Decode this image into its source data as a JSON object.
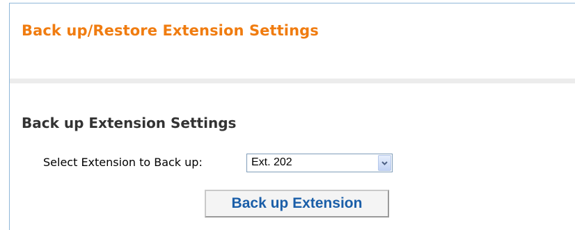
{
  "header": {
    "title": "Back up/Restore Extension Settings"
  },
  "backup_section": {
    "heading": "Back up Extension Settings",
    "select_label": "Select Extension to Back up:",
    "selected_extension": "Ext. 202",
    "button_label": "Back up Extension"
  },
  "colors": {
    "title": "#f07c10",
    "heading": "#333333",
    "button_text": "#1a5ea8",
    "frame_border": "#8fb7d8",
    "divider": "#ececec"
  },
  "icons": {
    "select_arrow": "chevron-down-icon"
  }
}
